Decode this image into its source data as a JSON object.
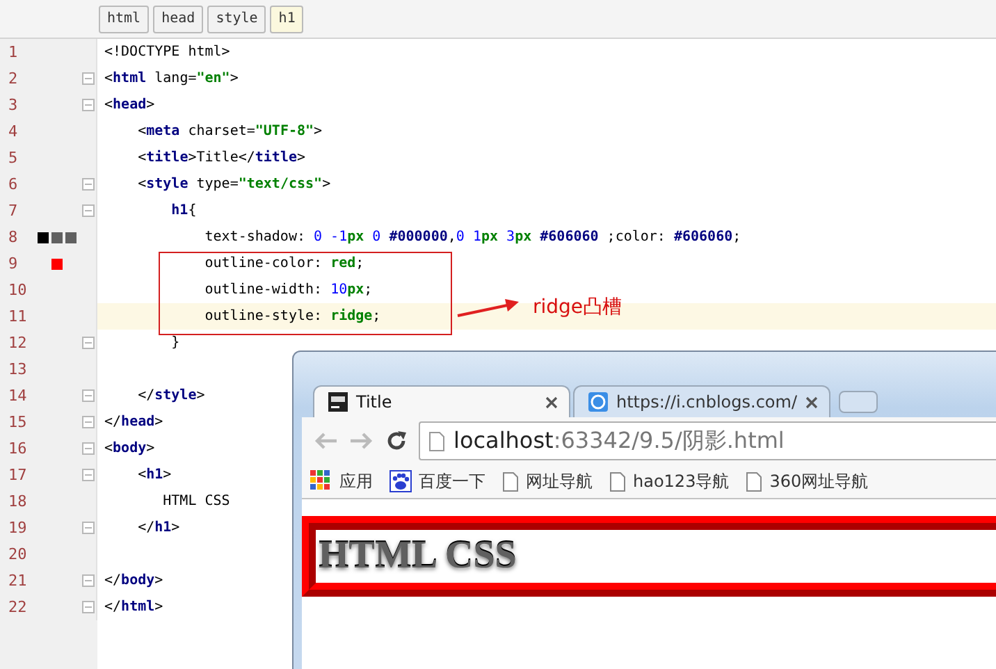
{
  "breadcrumb": [
    {
      "label": "html",
      "selected": false
    },
    {
      "label": "head",
      "selected": false
    },
    {
      "label": "style",
      "selected": false
    },
    {
      "label": "h1",
      "selected": true
    }
  ],
  "code_lines": [
    {
      "number": "1",
      "fold": false,
      "current": false,
      "tokens": [
        {
          "text": "<!DOCTYPE html>",
          "kind": "plain"
        }
      ]
    },
    {
      "number": "2",
      "fold": true,
      "current": false,
      "tokens": [
        {
          "text": "<",
          "kind": "plain"
        },
        {
          "text": "html",
          "kind": "tag"
        },
        {
          "text": " lang=",
          "kind": "plain"
        },
        {
          "text": "\"en\"",
          "kind": "str"
        },
        {
          "text": ">",
          "kind": "plain"
        }
      ]
    },
    {
      "number": "3",
      "fold": true,
      "current": false,
      "tokens": [
        {
          "text": "<",
          "kind": "plain"
        },
        {
          "text": "head",
          "kind": "tag"
        },
        {
          "text": ">",
          "kind": "plain"
        }
      ]
    },
    {
      "number": "4",
      "fold": false,
      "current": false,
      "tokens": [
        {
          "text": "    <",
          "kind": "plain"
        },
        {
          "text": "meta",
          "kind": "tag"
        },
        {
          "text": " charset=",
          "kind": "plain"
        },
        {
          "text": "\"UTF-8\"",
          "kind": "str"
        },
        {
          "text": ">",
          "kind": "plain"
        }
      ]
    },
    {
      "number": "5",
      "fold": false,
      "current": false,
      "tokens": [
        {
          "text": "    <",
          "kind": "plain"
        },
        {
          "text": "title",
          "kind": "tag"
        },
        {
          "text": ">Title</",
          "kind": "plain"
        },
        {
          "text": "title",
          "kind": "tag"
        },
        {
          "text": ">",
          "kind": "plain"
        }
      ]
    },
    {
      "number": "6",
      "fold": true,
      "current": false,
      "tokens": [
        {
          "text": "    <",
          "kind": "plain"
        },
        {
          "text": "style",
          "kind": "tag"
        },
        {
          "text": " type=",
          "kind": "plain"
        },
        {
          "text": "\"text/css\"",
          "kind": "str"
        },
        {
          "text": ">",
          "kind": "plain"
        }
      ]
    },
    {
      "number": "7",
      "fold": true,
      "current": false,
      "tokens": [
        {
          "text": "        h1",
          "kind": "tag"
        },
        {
          "text": "{",
          "kind": "plain"
        }
      ]
    },
    {
      "number": "8",
      "fold": false,
      "current": false,
      "swatches": [
        {
          "color": "#000000"
        },
        {
          "color": "#606060"
        },
        {
          "color": "#606060"
        }
      ],
      "tokens": [
        {
          "text": "            text-shadow: ",
          "kind": "plain"
        },
        {
          "text": "0 -1",
          "kind": "num"
        },
        {
          "text": "px",
          "kind": "unit"
        },
        {
          "text": " 0 ",
          "kind": "num"
        },
        {
          "text": "#000000",
          "kind": "hex"
        },
        {
          "text": ",",
          "kind": "plain"
        },
        {
          "text": "0 1",
          "kind": "num"
        },
        {
          "text": "px",
          "kind": "unit"
        },
        {
          "text": " 3",
          "kind": "num"
        },
        {
          "text": "px",
          "kind": "unit"
        },
        {
          "text": " #606060",
          "kind": "hex"
        },
        {
          "text": " ;color: ",
          "kind": "plain"
        },
        {
          "text": "#606060",
          "kind": "hex"
        },
        {
          "text": ";",
          "kind": "plain"
        }
      ]
    },
    {
      "number": "9",
      "fold": false,
      "current": false,
      "swatches": [
        {
          "color": "#ff0000"
        }
      ],
      "tokens": [
        {
          "text": "            outline-color: ",
          "kind": "plain"
        },
        {
          "text": "red",
          "kind": "kw"
        },
        {
          "text": ";",
          "kind": "plain"
        }
      ]
    },
    {
      "number": "10",
      "fold": false,
      "current": false,
      "tokens": [
        {
          "text": "            outline-width: ",
          "kind": "plain"
        },
        {
          "text": "10",
          "kind": "num"
        },
        {
          "text": "px",
          "kind": "unit"
        },
        {
          "text": ";",
          "kind": "plain"
        }
      ]
    },
    {
      "number": "11",
      "fold": false,
      "current": true,
      "tokens": [
        {
          "text": "            outline-style: ",
          "kind": "plain"
        },
        {
          "text": "ridge",
          "kind": "kw"
        },
        {
          "text": ";",
          "kind": "plain"
        }
      ]
    },
    {
      "number": "12",
      "fold": true,
      "current": false,
      "tokens": [
        {
          "text": "        }",
          "kind": "plain"
        }
      ]
    },
    {
      "number": "13",
      "fold": false,
      "current": false
    },
    {
      "number": "14",
      "fold": true,
      "current": false,
      "tokens": [
        {
          "text": "    </",
          "kind": "plain"
        },
        {
          "text": "style",
          "kind": "tag"
        },
        {
          "text": ">",
          "kind": "plain"
        }
      ]
    },
    {
      "number": "15",
      "fold": true,
      "current": false,
      "tokens": [
        {
          "text": "</",
          "kind": "plain"
        },
        {
          "text": "head",
          "kind": "tag"
        },
        {
          "text": ">",
          "kind": "plain"
        }
      ]
    },
    {
      "number": "16",
      "fold": true,
      "current": false,
      "tokens": [
        {
          "text": "<",
          "kind": "plain"
        },
        {
          "text": "body",
          "kind": "tag"
        },
        {
          "text": ">",
          "kind": "plain"
        }
      ]
    },
    {
      "number": "17",
      "fold": true,
      "current": false,
      "tokens": [
        {
          "text": "    <",
          "kind": "plain"
        },
        {
          "text": "h1",
          "kind": "tag"
        },
        {
          "text": ">",
          "kind": "plain"
        }
      ]
    },
    {
      "number": "18",
      "fold": false,
      "current": false,
      "tokens": [
        {
          "text": "       HTML CSS",
          "kind": "plain"
        }
      ]
    },
    {
      "number": "19",
      "fold": true,
      "current": false,
      "tokens": [
        {
          "text": "    </",
          "kind": "plain"
        },
        {
          "text": "h1",
          "kind": "tag"
        },
        {
          "text": ">",
          "kind": "plain"
        }
      ]
    },
    {
      "number": "20",
      "fold": false,
      "current": false
    },
    {
      "number": "21",
      "fold": true,
      "current": false,
      "tokens": [
        {
          "text": "</",
          "kind": "plain"
        },
        {
          "text": "body",
          "kind": "tag"
        },
        {
          "text": ">",
          "kind": "plain"
        }
      ]
    },
    {
      "number": "22",
      "fold": true,
      "current": false,
      "tokens": [
        {
          "text": "</",
          "kind": "plain"
        },
        {
          "text": "html",
          "kind": "tag"
        },
        {
          "text": ">",
          "kind": "plain"
        }
      ]
    }
  ],
  "annotation": {
    "text": "ridge凸槽"
  },
  "browser": {
    "tabs": [
      {
        "title": "Title",
        "kind": "app",
        "selected": true
      },
      {
        "title": "https://i.cnblogs.com/",
        "kind": "site",
        "selected": false
      }
    ],
    "address": {
      "host": "localhost",
      "path": ":63342/9.5/阴影.html"
    },
    "bookmarks": [
      {
        "label": "应用",
        "kind": "apps"
      },
      {
        "label": "百度一下",
        "kind": "site"
      },
      {
        "label": "网址导航",
        "kind": "page"
      },
      {
        "label": "hao123导航",
        "kind": "page"
      },
      {
        "label": "360网址导航",
        "kind": "page"
      }
    ],
    "page_heading": "HTML CSS"
  }
}
